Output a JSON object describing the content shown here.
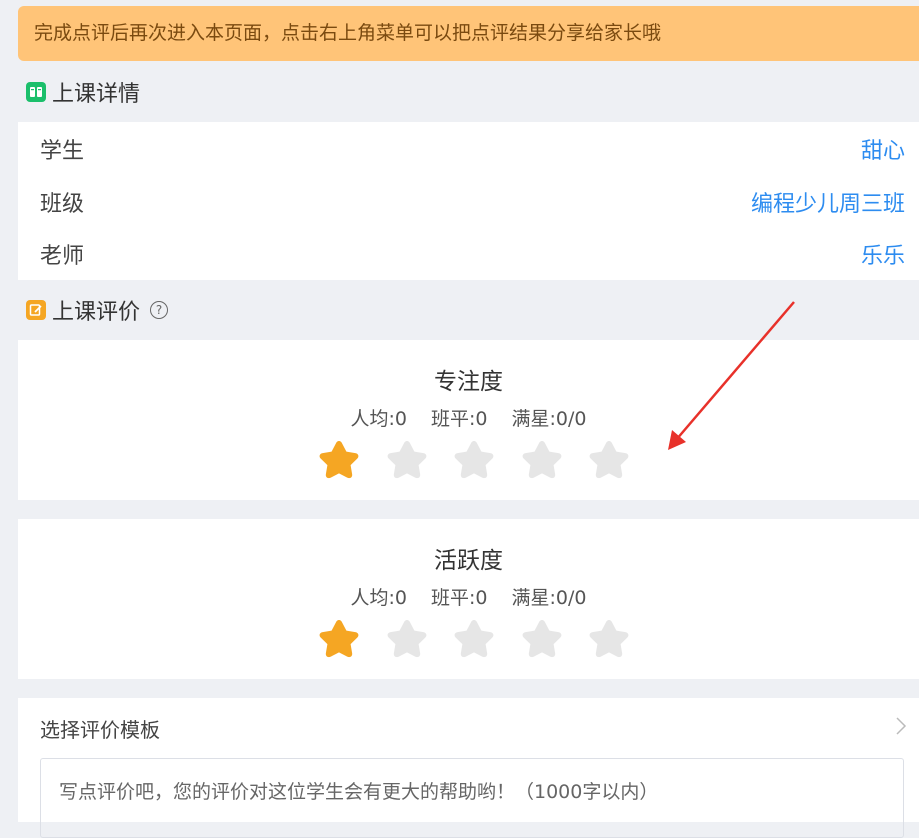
{
  "notice": "完成点评后再次进入本页面，点击右上角菜单可以把点评结果分享给家长哦",
  "detail_section": {
    "title": "上课详情",
    "icon": "class-detail-icon"
  },
  "detail": {
    "student": {
      "label": "学生",
      "value": "甜心"
    },
    "class": {
      "label": "班级",
      "value": "编程少儿周三班"
    },
    "teacher": {
      "label": "老师",
      "value": "乐乐"
    }
  },
  "eval_section": {
    "title": "上课评价",
    "help": "?",
    "icon": "evaluation-icon"
  },
  "evaluations": [
    {
      "title": "专注度",
      "avg": "人均:0",
      "class_avg": "班平:0",
      "full": "满星:0/0",
      "rating": 1,
      "max": 5
    },
    {
      "title": "活跃度",
      "avg": "人均:0",
      "class_avg": "班平:0",
      "full": "满星:0/0",
      "rating": 1,
      "max": 5
    }
  ],
  "template": {
    "label": "选择评价模板",
    "placeholder": "写点评价吧，您的评价对这位学生会有更大的帮助哟！（1000字以内）"
  },
  "colors": {
    "star_active": "#f5a623",
    "star_inactive": "#e6e6e6",
    "link": "#2d8cf0",
    "notice_bg": "#ffc478",
    "annotation_arrow": "#e8312a"
  }
}
